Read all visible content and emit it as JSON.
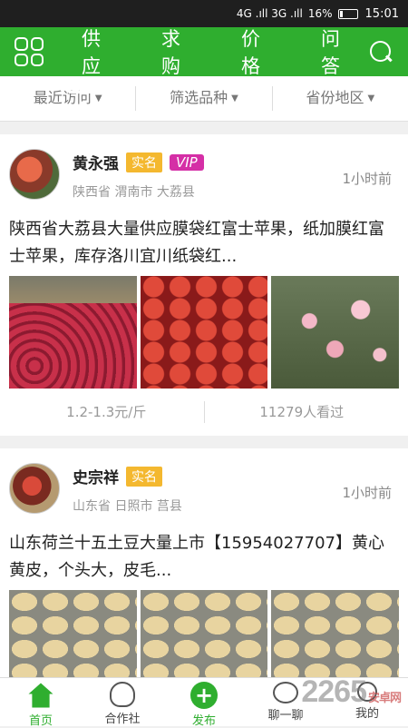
{
  "status_bar": {
    "signal": "4G .ıll 3G .ıll",
    "battery": "16%",
    "time": "15:01"
  },
  "top_nav": {
    "tabs": [
      {
        "label": "供应",
        "active": true
      },
      {
        "label": "求购",
        "active": false
      },
      {
        "label": "价格",
        "active": false
      },
      {
        "label": "问答",
        "active": false
      }
    ]
  },
  "filters": [
    "最近访问",
    "筛选品种",
    "省份地区"
  ],
  "posts": [
    {
      "name": "黄永强",
      "badge_real": "实名",
      "badge_vip": "VIP",
      "location": "陕西省 渭南市 大荔县",
      "time": "1小时前",
      "text": "陕西省大荔县大量供应膜袋红富士苹果，纸加膜红富士苹果，库存洛川宜川纸袋红...",
      "price": "1.2-1.3元/斤",
      "views": "11279人看过"
    },
    {
      "name": "史宗祥",
      "badge_real": "实名",
      "location": "山东省 日照市 莒县",
      "time": "1小时前",
      "text": "山东荷兰十五土豆大量上市【15954027707】黄心黄皮，个头大，皮毛..."
    }
  ],
  "bottom_nav": [
    {
      "label": "首页",
      "active": true
    },
    {
      "label": "合作社",
      "active": false
    },
    {
      "label": "发布",
      "active": false
    },
    {
      "label": "聊一聊",
      "active": false
    },
    {
      "label": "我的",
      "active": false
    }
  ],
  "watermark": {
    "text": "2265",
    "suffix": "安卓网"
  },
  "colors": {
    "primary": "#2fae2f",
    "badge_real": "#f4b82f",
    "badge_vip": "#d52fa6"
  }
}
